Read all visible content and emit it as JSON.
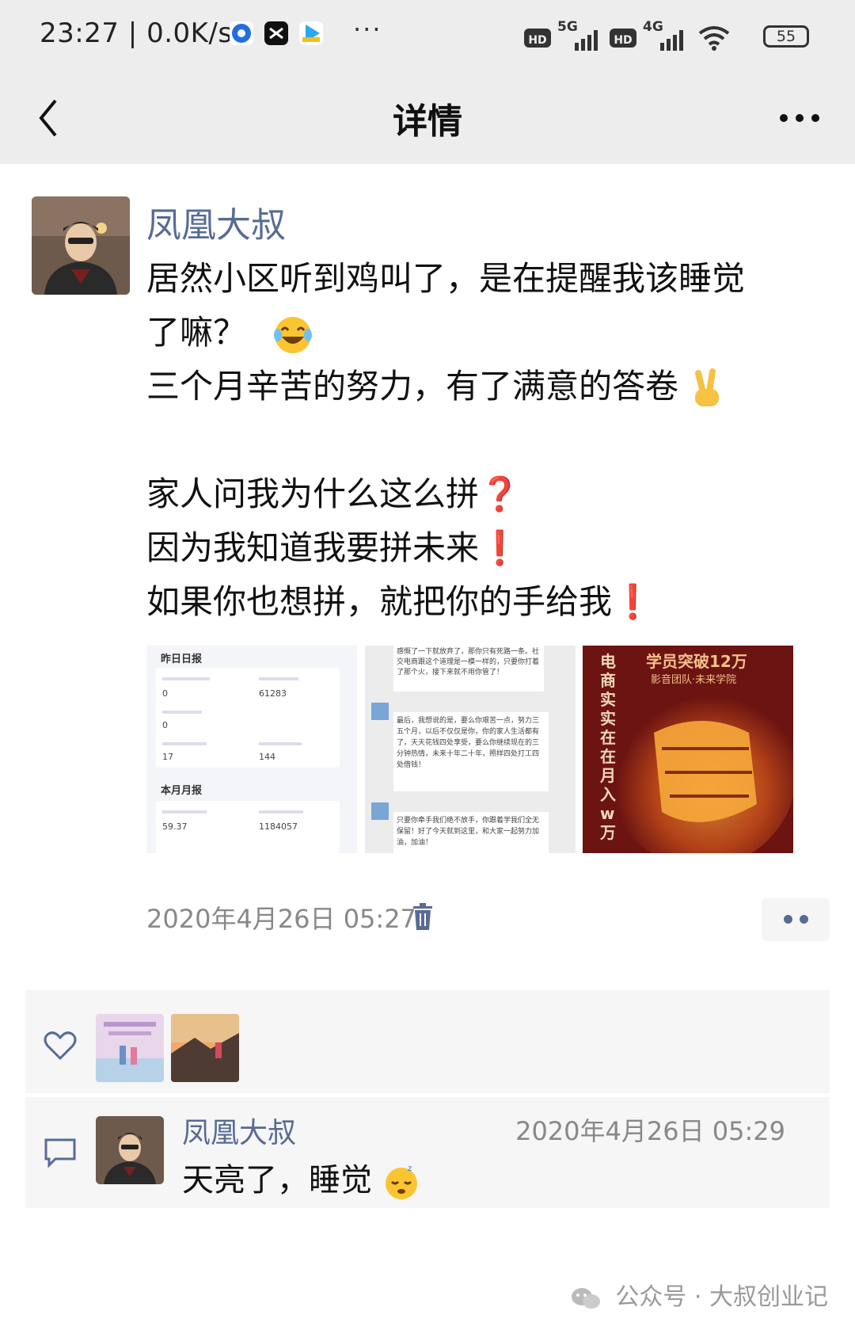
{
  "status_bar": {
    "time": "23:27",
    "speed": "0.0K/s",
    "more": "···",
    "network_1": "5G",
    "network_2": "4G",
    "hd": "HD",
    "battery": "55"
  },
  "nav": {
    "title": "详情",
    "back_icon": "chevron-left-icon",
    "more_icon": "more-dots-icon"
  },
  "post": {
    "author": "凤凰大叔",
    "line1": "居然小区听到鸡叫了，是在提醒我该睡觉",
    "line2": "了嘛？",
    "line3": "三个月辛苦的努力，有了满意的答卷",
    "line4": "家人问我为什么这么拼",
    "line5": "因为我知道我要拼未来",
    "line6": "如果你也想拼，就把你的手给我",
    "q_mark": "❓",
    "excl_mark": "❗",
    "timestamp": "2020年4月26日 05:27"
  },
  "thumb1": {
    "section1": "昨日日报",
    "section2": "本月月报",
    "v1": "0",
    "v2": "61283",
    "v3": "0",
    "v4": "17",
    "v5": "144",
    "v6": "59.37",
    "v7": "1184057"
  },
  "thumb2": {
    "p1": "感慨了一下就放弃了，那你只有死路一条。社交电商跟这个道理是一模一样的，只要你打着了那个火，接下来就不用你管了！",
    "p2": "最后，我想说的是，要么你艰苦一点，努力三五个月，以后不仅仅是你，你的家人生活都有了，天天花钱四处享受，要么你继续现在的三分钟热情，未来十年二十年，照样四处打工四处借钱！",
    "p3": "只要你牵手我们绝不放手，你跟着学我们全无保留！好了今天就到这里，和大家一起努力加油，加油！"
  },
  "thumb3": {
    "title": "学员突破12万",
    "subtitle": "影音团队·未来学院",
    "vertical": "电商实实在在月入w万"
  },
  "interactions": {
    "comment_author": "凤凰大叔",
    "comment_time": "2020年4月26日 05:29",
    "comment_text": "天亮了，睡觉"
  },
  "watermark": "公众号 · 大叔创业记",
  "colors": {
    "link_blue": "#576b95",
    "header_bg": "#ededed",
    "comment_bg": "#f6f6f6",
    "red": "#d9242b"
  }
}
